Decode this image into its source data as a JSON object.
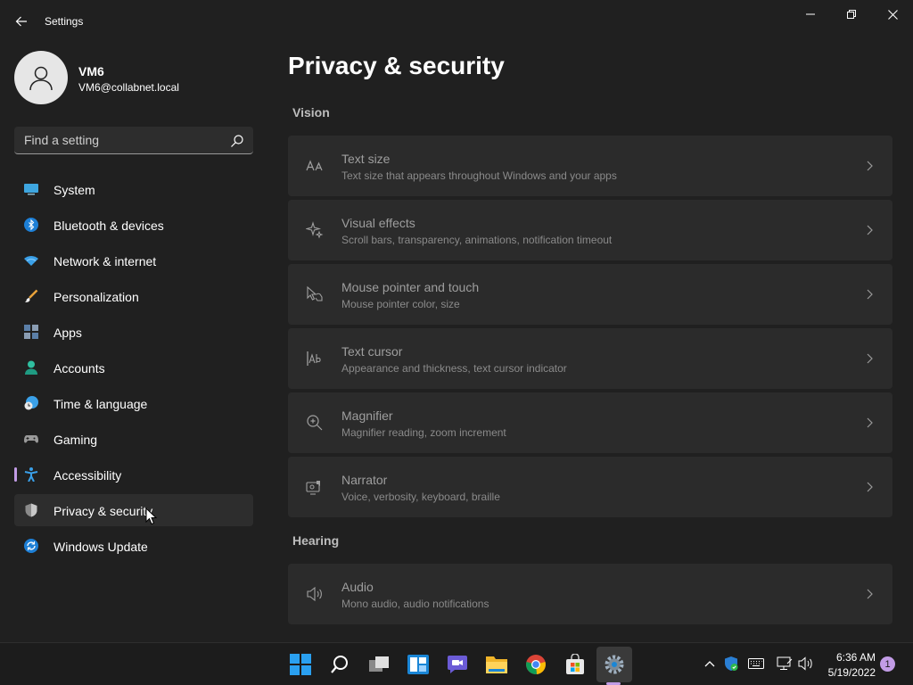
{
  "window": {
    "title": "Settings"
  },
  "profile": {
    "name": "VM6",
    "email": "VM6@collabnet.local"
  },
  "search": {
    "placeholder": "Find a setting"
  },
  "sidebar": {
    "items": [
      {
        "label": "System",
        "icon": "monitor-icon"
      },
      {
        "label": "Bluetooth & devices",
        "icon": "bluetooth-icon"
      },
      {
        "label": "Network & internet",
        "icon": "wifi-icon"
      },
      {
        "label": "Personalization",
        "icon": "brush-icon"
      },
      {
        "label": "Apps",
        "icon": "apps-icon"
      },
      {
        "label": "Accounts",
        "icon": "person-icon"
      },
      {
        "label": "Time & language",
        "icon": "clock-globe-icon"
      },
      {
        "label": "Gaming",
        "icon": "gamepad-icon"
      },
      {
        "label": "Accessibility",
        "icon": "accessibility-icon"
      },
      {
        "label": "Privacy & security",
        "icon": "shield-icon"
      },
      {
        "label": "Windows Update",
        "icon": "update-icon"
      }
    ],
    "indicator_item": "Accessibility",
    "hover_item": "Privacy & security"
  },
  "main": {
    "title": "Privacy & security",
    "sections": [
      {
        "heading": "Vision",
        "cards": [
          {
            "title": "Text size",
            "subtitle": "Text size that appears throughout Windows and your apps",
            "icon": "text-size-icon"
          },
          {
            "title": "Visual effects",
            "subtitle": "Scroll bars, transparency, animations, notification timeout",
            "icon": "sparkle-icon"
          },
          {
            "title": "Mouse pointer and touch",
            "subtitle": "Mouse pointer color, size",
            "icon": "pointer-touch-icon"
          },
          {
            "title": "Text cursor",
            "subtitle": "Appearance and thickness, text cursor indicator",
            "icon": "text-cursor-icon"
          },
          {
            "title": "Magnifier",
            "subtitle": "Magnifier reading, zoom increment",
            "icon": "magnifier-icon"
          },
          {
            "title": "Narrator",
            "subtitle": "Voice, verbosity, keyboard, braille",
            "icon": "narrator-icon"
          }
        ]
      },
      {
        "heading": "Hearing",
        "cards": [
          {
            "title": "Audio",
            "subtitle": "Mono audio, audio notifications",
            "icon": "speaker-icon"
          }
        ]
      }
    ]
  },
  "taskbar": {
    "apps": [
      "start-icon",
      "search-icon",
      "task-view-icon",
      "widgets-icon",
      "chat-icon",
      "file-explorer-icon",
      "chrome-icon",
      "store-icon",
      "settings-icon"
    ],
    "clock_time": "6:36 AM",
    "clock_date": "5/19/2022",
    "notification_count": "1"
  },
  "colors": {
    "background": "#202020",
    "card": "#2b2b2b",
    "accent": "#c29ce6"
  }
}
